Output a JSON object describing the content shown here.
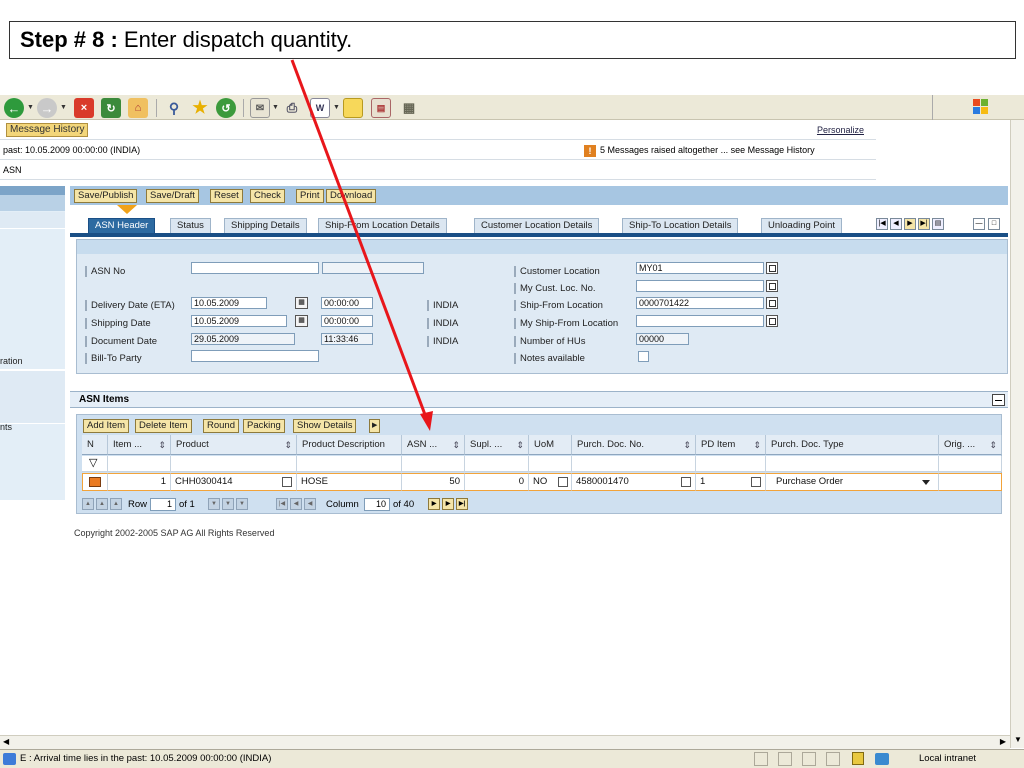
{
  "step": {
    "number": "Step # 8 :",
    "text": " Enter dispatch quantity."
  },
  "header": {
    "message_history": "Message History",
    "personalize": "Personalize",
    "past_line": "past: 10.05.2009 00:00:00 (INDIA)",
    "messages_raised": "5 Messages raised altogether ... see Message History",
    "asn_label": "ASN"
  },
  "left_nav": {
    "items": [
      "ration",
      "nts"
    ]
  },
  "actions": [
    "Save/Publish",
    "Save/Draft",
    "Reset",
    "Check",
    "Print",
    "Download"
  ],
  "tabs": [
    "ASN Header",
    "Status",
    "Shipping Details",
    "Ship-From Location Details",
    "Customer Location Details",
    "Ship-To Location Details",
    "Unloading Point"
  ],
  "active_tab": "ASN Header",
  "form": {
    "asn_no_label": "ASN No",
    "delivery_date_label": "Delivery Date (ETA)",
    "delivery_date": "10.05.2009",
    "delivery_time": "00:00:00",
    "shipping_date_label": "Shipping Date",
    "shipping_date": "10.05.2009",
    "shipping_time": "00:00:00",
    "document_date_label": "Document Date",
    "document_date": "29.05.2009",
    "document_time": "11:33:46",
    "bill_to_label": "Bill-To Party",
    "timezone": "INDIA",
    "customer_location_label": "Customer Location",
    "customer_location": "MY01",
    "my_cust_loc_label": "My Cust. Loc. No.",
    "ship_from_label": "Ship-From Location",
    "ship_from": "0000701422",
    "my_ship_from_label": "My Ship-From Location",
    "num_hus_label": "Number of HUs",
    "num_hus": "00000",
    "notes_label": "Notes available"
  },
  "items": {
    "title": "ASN Items",
    "buttons": [
      "Add Item",
      "Delete Item",
      "Round",
      "Packing",
      "Show Details"
    ],
    "columns": [
      "N",
      "Item ...",
      "Product",
      "Product Description",
      "ASN ...",
      "Supl. ...",
      "UoM",
      "Purch. Doc. No.",
      "PD Item",
      "Purch. Doc. Type",
      "Orig. ..."
    ],
    "row": {
      "item": "1",
      "product": "CHH0300414",
      "description": "HOSE",
      "asn_qty": "50",
      "supl_qty": "0",
      "uom": "NO",
      "purch_doc": "4580001470",
      "pd_item": "1",
      "doc_type": "Purchase Order"
    },
    "pager": {
      "row_label": "Row",
      "row_value": "1",
      "row_of": "of 1",
      "col_label": "Column",
      "col_value": "10",
      "col_of": "of 40"
    }
  },
  "copyright": "Copyright 2002-2005 SAP AG All Rights Reserved",
  "status_bar": {
    "text": "E : Arrival time lies in the past: 10.05.2009 00:00:00 (INDIA)",
    "zone": "Local intranet"
  },
  "colors": {
    "annotation": "#e8161b",
    "sap_button": "#f5e5a8",
    "active_tab": "#2d6aa1"
  }
}
